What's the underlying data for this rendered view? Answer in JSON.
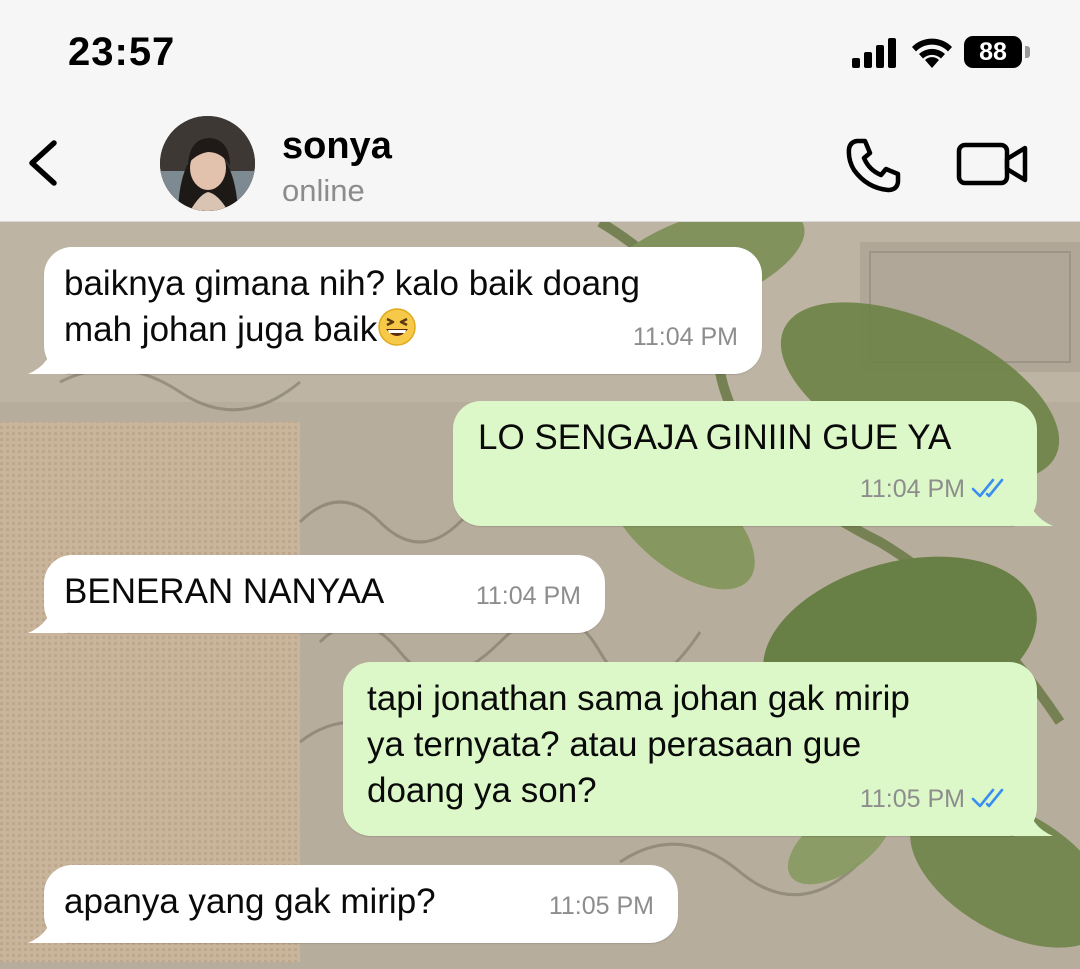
{
  "status_bar": {
    "time": "23:57",
    "battery": "88"
  },
  "header": {
    "contact_name": "sonya",
    "contact_status": "online"
  },
  "messages": [
    {
      "direction": "incoming",
      "lines": [
        "baiknya gimana nih? kalo baik doang",
        "mah johan juga baik"
      ],
      "emoji": "grinning-squinting-face",
      "time": "11:04 PM"
    },
    {
      "direction": "outgoing",
      "lines": [
        "LO SENGAJA GINIIN GUE YA"
      ],
      "time": "11:04 PM",
      "read": true
    },
    {
      "direction": "incoming",
      "lines": [
        "BENERAN NANYAA"
      ],
      "time": "11:04 PM"
    },
    {
      "direction": "outgoing",
      "lines": [
        "tapi jonathan sama johan gak mirip",
        "ya ternyata? atau perasaan gue",
        "doang ya son?"
      ],
      "time": "11:05 PM",
      "read": true
    },
    {
      "direction": "incoming",
      "lines": [
        "apanya yang gak mirip?"
      ],
      "time": "11:05 PM"
    }
  ],
  "colors": {
    "incoming_bubble": "#ffffff",
    "outgoing_bubble": "#dcf8c8",
    "read_ticks": "#3a8ef0",
    "header_bg": "#f6f6f6"
  },
  "icons": [
    "back-chevron-icon",
    "phone-icon",
    "video-camera-icon",
    "signal-icon",
    "wifi-icon",
    "battery-icon",
    "double-check-icon"
  ]
}
